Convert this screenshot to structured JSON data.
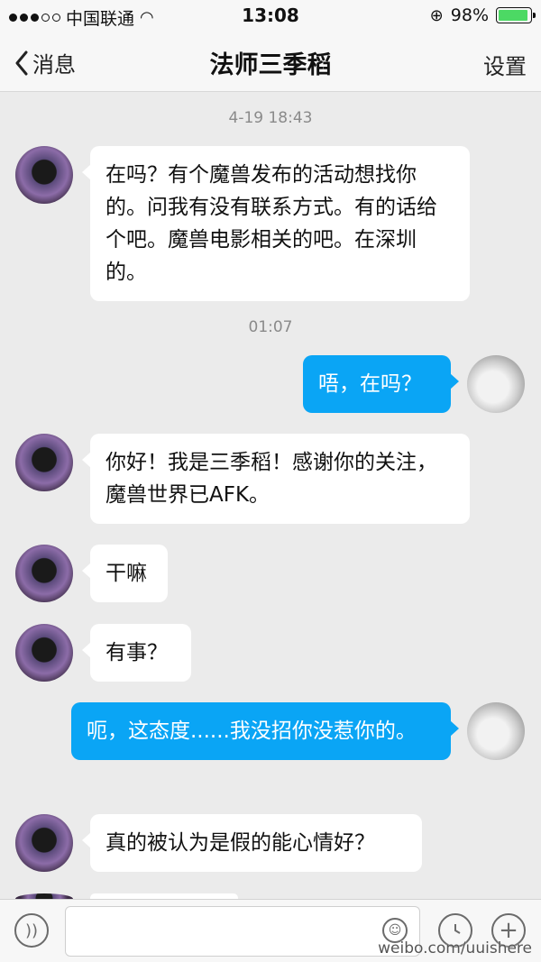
{
  "status_bar": {
    "carrier": "中国联通",
    "time": "13:08",
    "battery": "98%"
  },
  "nav": {
    "back_label": "消息",
    "title": "法师三季稻",
    "settings_label": "设置"
  },
  "chat": {
    "timestamps": [
      "4-19 18:43",
      "01:07"
    ],
    "messages": [
      {
        "sender": "other",
        "text": "在吗？有个魔兽发布的活动想找你的。问我有没有联系方式。有的话给个吧。魔兽电影相关的吧。在深圳的。"
      },
      {
        "sender": "me",
        "text": "唔，在吗？"
      },
      {
        "sender": "other",
        "text": "你好！我是三季稻！感谢你的关注，魔兽世界已AFK。"
      },
      {
        "sender": "other",
        "text": "干嘛"
      },
      {
        "sender": "other",
        "text": "有事？"
      },
      {
        "sender": "me",
        "text": "呃，这态度......我没招你没惹你的。"
      },
      {
        "sender": "other",
        "text": "真的被认为是假的能心情好？"
      }
    ]
  },
  "input_bar": {
    "placeholder": ""
  },
  "watermark": "weibo.com/uuishere",
  "colors": {
    "outgoing_bubble": "#0aa5f5",
    "incoming_bubble": "#ffffff",
    "background": "#ebebeb"
  }
}
